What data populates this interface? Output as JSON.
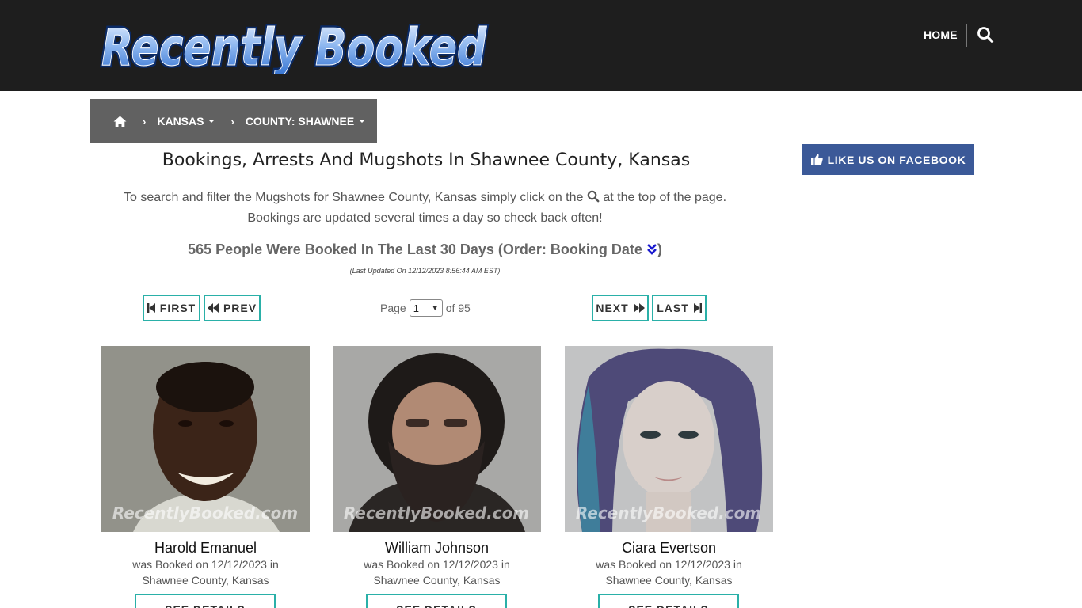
{
  "header": {
    "logo_text": "Recently Booked",
    "nav_home": "HOME",
    "search_icon": "search-icon"
  },
  "breadcrumb": {
    "home_icon": "home-icon",
    "state": "KANSAS",
    "county": "COUNTY: SHAWNEE"
  },
  "main": {
    "title": "Bookings, Arrests And Mugshots In Shawnee County, Kansas",
    "intro_before_icon": "To search and filter the Mugshots for Shawnee County, Kansas simply click on the",
    "intro_after_icon": "at the top of the page.",
    "intro_line2": "Bookings are updated several times a day so check back often!",
    "count_text": "565 People Were Booked In The Last 30 Days (Order: Booking Date",
    "count_close": ")",
    "last_updated": "(Last Updated On 12/12/2023 8:56:44 AM EST)"
  },
  "pagination": {
    "first": "FIRST",
    "prev": "PREV",
    "next": "NEXT",
    "last": "LAST",
    "page_label": "Page",
    "page_value": "1",
    "of_label": "of 95"
  },
  "bookings": [
    {
      "name": "Harold Emanuel",
      "line1": "was Booked on 12/12/2023 in",
      "line2": "Shawnee County, Kansas",
      "button": "SEE DETAILS",
      "watermark": "RecentlyBooked.com"
    },
    {
      "name": "William Johnson",
      "line1": "was Booked on 12/12/2023 in",
      "line2": "Shawnee County, Kansas",
      "button": "SEE DETAILS",
      "watermark": "RecentlyBooked.com"
    },
    {
      "name": "Ciara Evertson",
      "line1": "was Booked on 12/12/2023 in",
      "line2": "Shawnee County, Kansas",
      "button": "SEE DETAILS",
      "watermark": "RecentlyBooked.com"
    }
  ],
  "sidebar": {
    "facebook_label": "LIKE US ON FACEBOOK"
  },
  "colors": {
    "header_bg": "#1e1e1e",
    "breadcrumb_bg": "#616161",
    "accent_teal": "#2ab0a8",
    "facebook_blue": "#3b5998"
  }
}
